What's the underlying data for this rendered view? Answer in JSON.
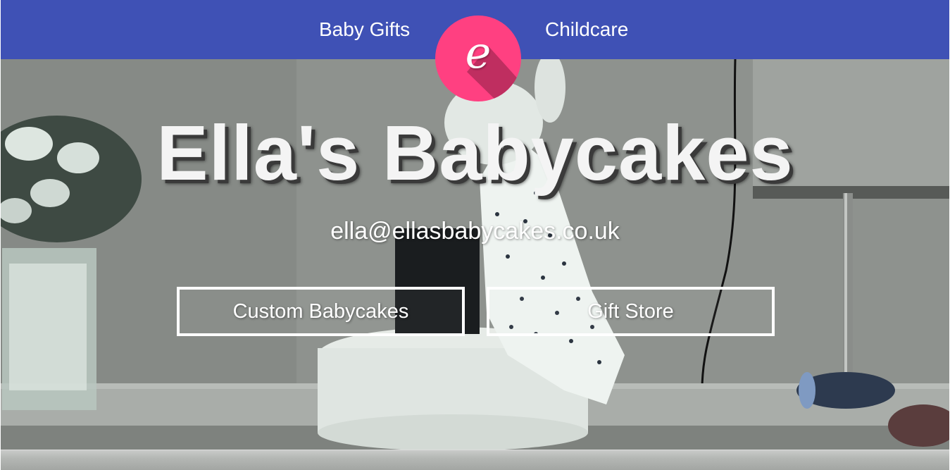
{
  "nav": {
    "left_link": "Baby Gifts",
    "right_link": "Childcare",
    "logo_letter": "e"
  },
  "hero": {
    "title": "Ella's Babycakes",
    "email": "ella@ellasbabycakes.co.uk",
    "buttons": [
      {
        "label": "Custom Babycakes"
      },
      {
        "label": "Gift Store"
      }
    ]
  },
  "colors": {
    "navbar": "#3f51b5",
    "logo": "#ff4081",
    "text": "#ffffff"
  },
  "icons": {
    "logo": "letter-e-logo-icon"
  }
}
